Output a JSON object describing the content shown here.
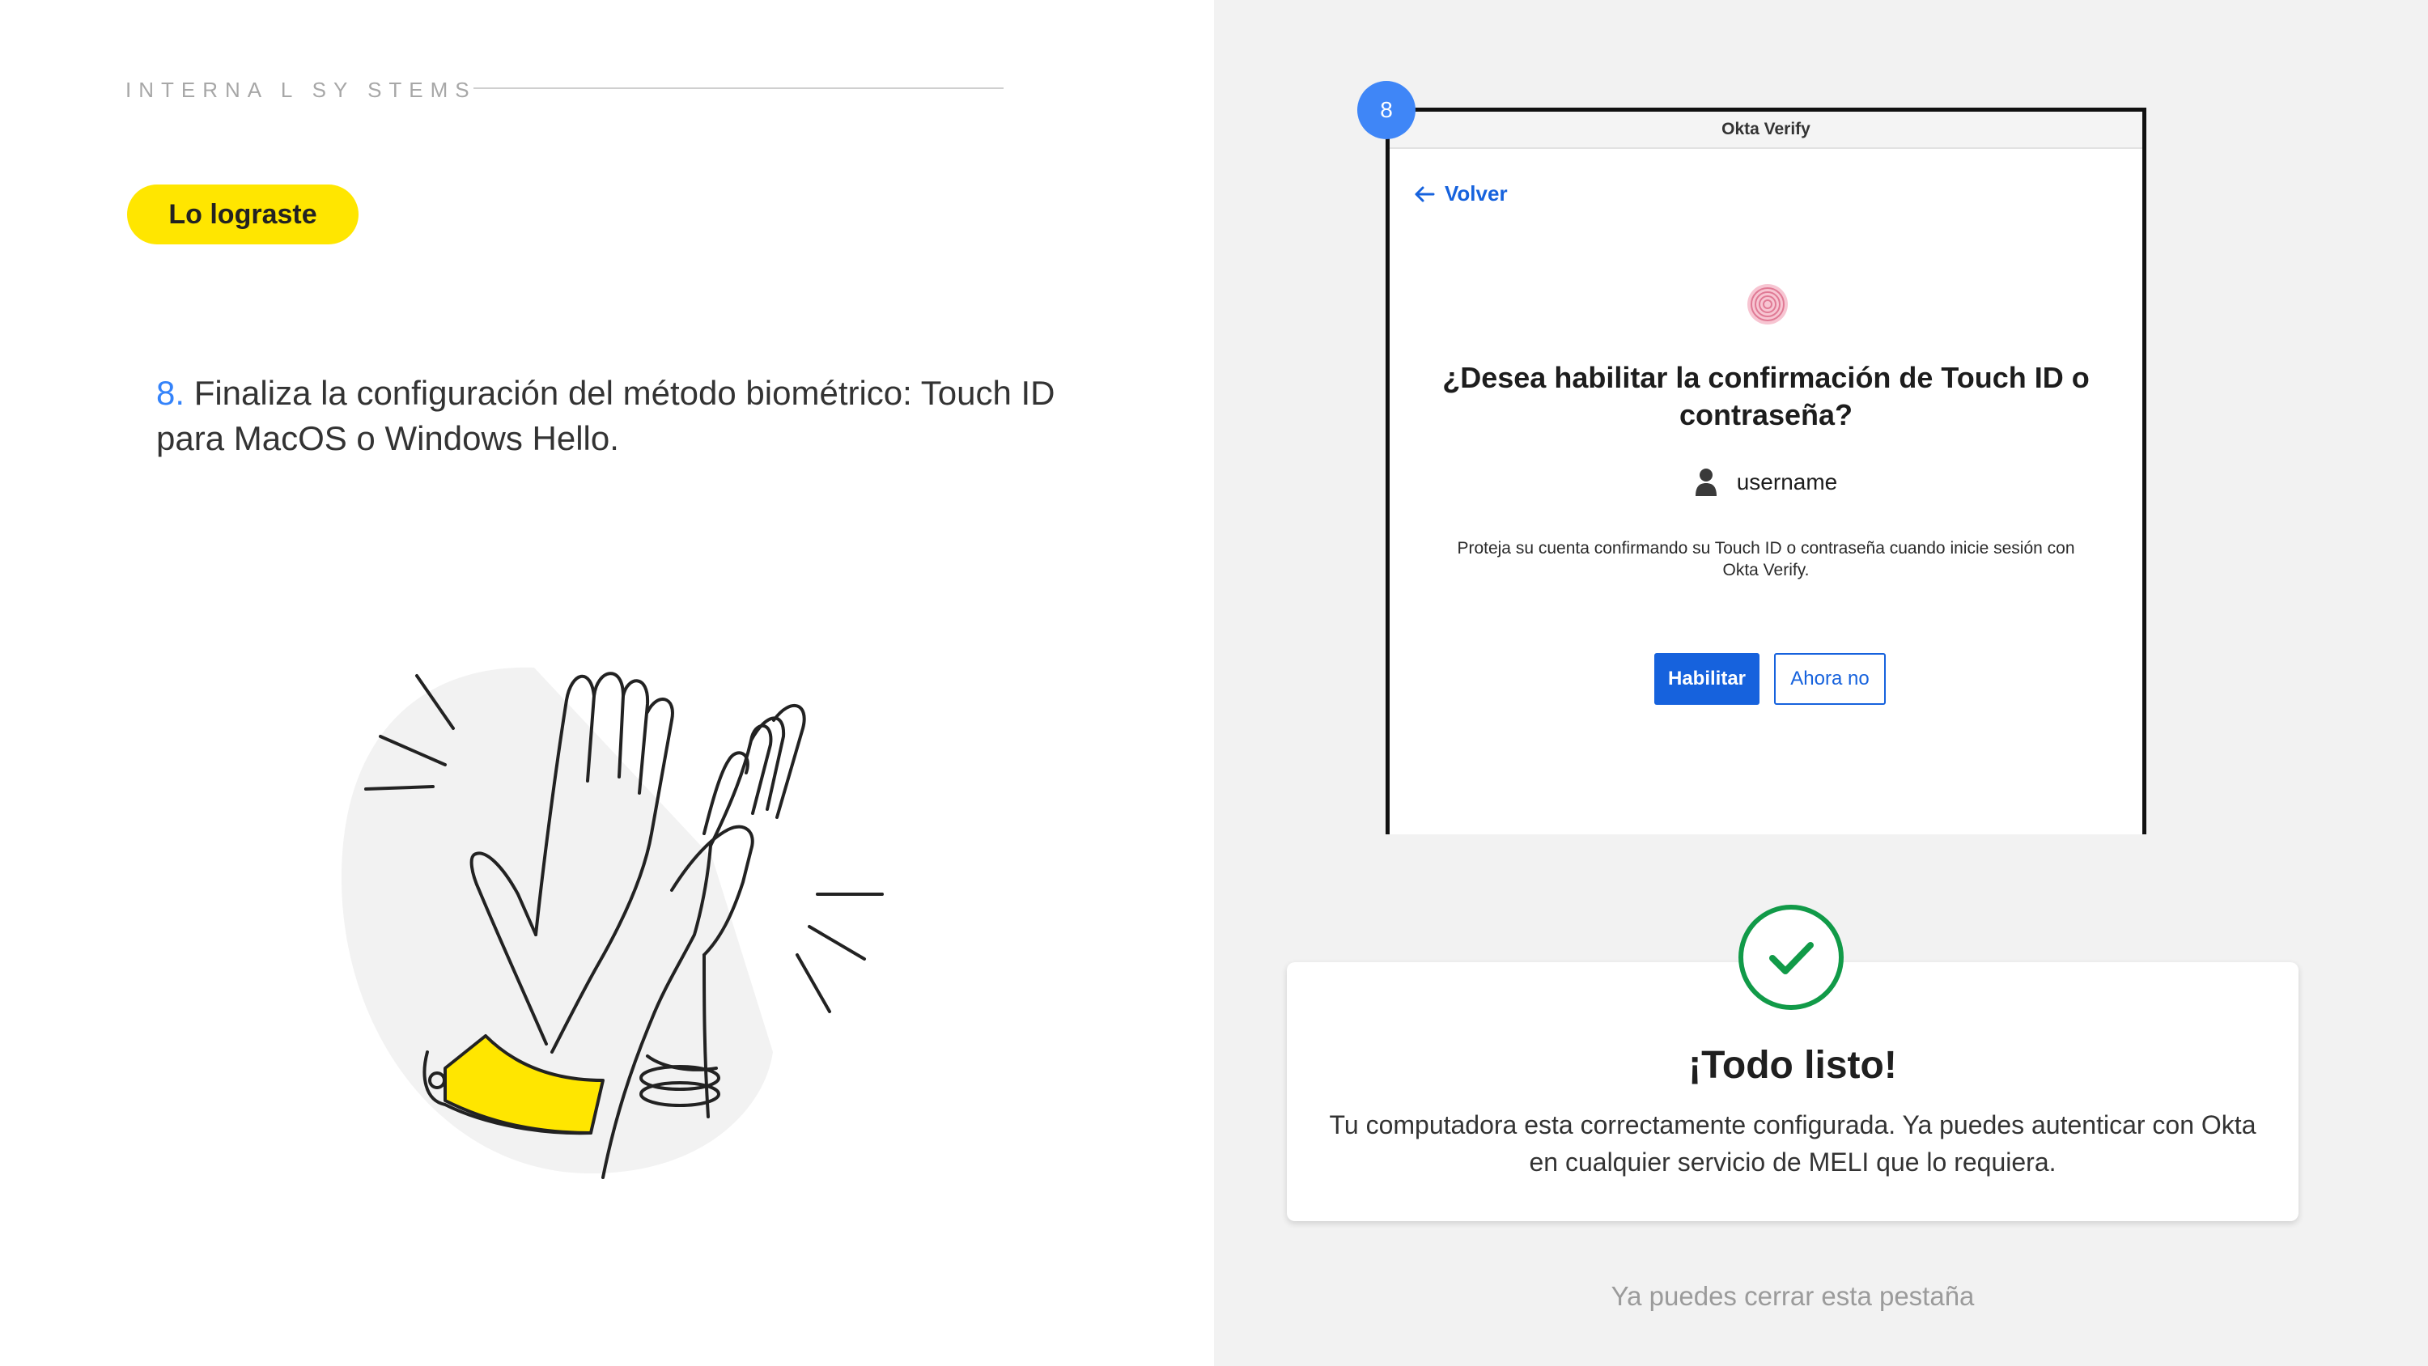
{
  "header": {
    "brand": "INTERNA L SY STEMS"
  },
  "badge": {
    "label": "Lo lograste"
  },
  "step": {
    "number": "8.",
    "text": " Finaliza la configuración del método biométrico: Touch ID para MacOS o Windows Hello."
  },
  "screenshot_step_badge": "8",
  "okta_window": {
    "title": "Okta Verify",
    "back_label": "Volver",
    "heading": "¿Desea habilitar la confirmación de Touch ID o contraseña?",
    "username": "username",
    "description": "Proteja su cuenta confirmando su Touch ID o contraseña cuando inicie sesión con Okta Verify.",
    "enable_button": "Habilitar",
    "later_button": "Ahora no"
  },
  "success_card": {
    "title": "¡Todo listo!",
    "text": "Tu computadora esta correctamente configurada. Ya puedes autenticar con Okta en cualquier servicio de MELI que lo requiera."
  },
  "footer_hint": "Ya puedes cerrar esta pestaña",
  "colors": {
    "accent_yellow": "#ffe600",
    "step_blue": "#3483fa",
    "okta_blue": "#1662dd",
    "success_green": "#119a48",
    "right_panel_bg": "#f2f2f2"
  },
  "icons": [
    "arrow-left-icon",
    "fingerprint-icon",
    "user-icon",
    "check-circle-icon",
    "high-five-illustration"
  ]
}
